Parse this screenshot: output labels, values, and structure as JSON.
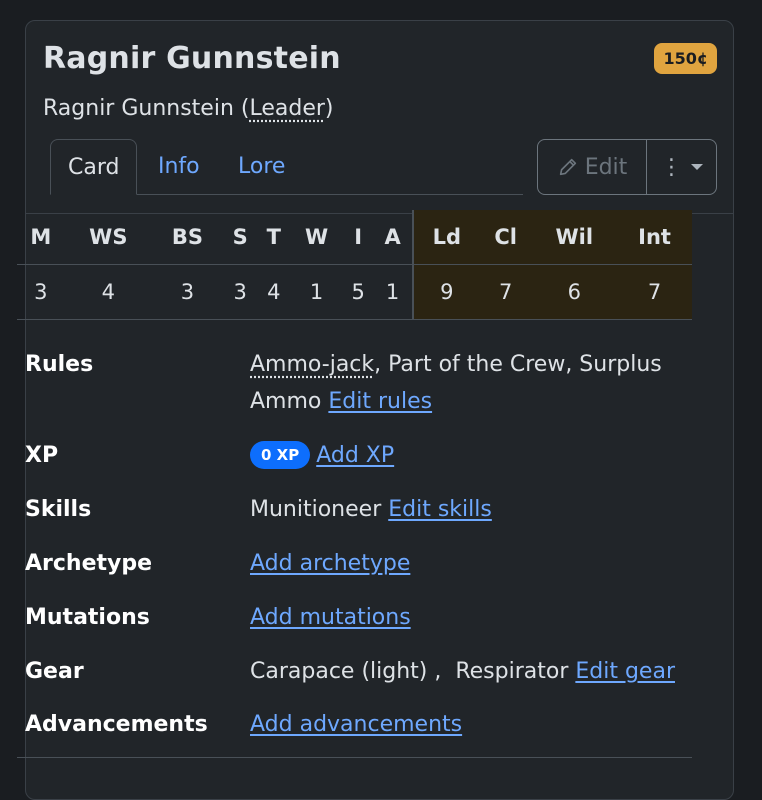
{
  "fighter": {
    "name": "Ragnir Gunnstein",
    "cost": "150¢",
    "subtitle_prefix": "Ragnir Gunnstein (",
    "role": "Leader",
    "subtitle_suffix": ")"
  },
  "tabs": [
    {
      "label": "Card",
      "active": true
    },
    {
      "label": "Info",
      "active": false
    },
    {
      "label": "Lore",
      "active": false
    }
  ],
  "actions": {
    "edit_label": "Edit",
    "more_glyph": "⋮"
  },
  "stats": {
    "headers": [
      "M",
      "WS",
      "BS",
      "S",
      "T",
      "W",
      "I",
      "A",
      "Ld",
      "Cl",
      "Wil",
      "Int"
    ],
    "values": [
      "3",
      "4",
      "3",
      "3",
      "4",
      "1",
      "5",
      "1",
      "9",
      "7",
      "6",
      "7"
    ]
  },
  "details": {
    "rules": {
      "label": "Rules",
      "item1": "Ammo-jack",
      "rest": ", Part of the Crew, Surplus Ammo ",
      "link": "Edit rules"
    },
    "xp": {
      "label": "XP",
      "badge": "0 XP",
      "link": "Add XP"
    },
    "skills": {
      "label": "Skills",
      "value": "Munitioneer ",
      "link": "Edit skills"
    },
    "archetype": {
      "label": "Archetype",
      "link": "Add archetype"
    },
    "mutations": {
      "label": "Mutations",
      "link": "Add mutations"
    },
    "gear": {
      "label": "Gear",
      "value": "Carapace (light) ,  Respirator ",
      "link": "Edit gear"
    },
    "advancements": {
      "label": "Advancements",
      "link": "Add advancements"
    }
  },
  "colors": {
    "accent_link": "#6ea8fe",
    "cost_badge": "#e0a43f",
    "xp_badge": "#0d6efd",
    "highlight_stats": "#2b2412"
  }
}
